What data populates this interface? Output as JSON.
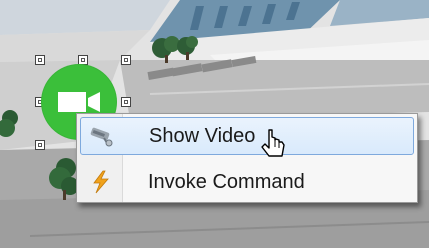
{
  "context_menu": {
    "items": [
      {
        "label": "Show Video",
        "icon": "security-camera-icon",
        "highlighted": true
      },
      {
        "label": "Invoke Command",
        "icon": "lightning-bolt-icon",
        "highlighted": false
      }
    ]
  },
  "map": {
    "marker_icon": "video-camera-icon",
    "marker_color": "#3bbf3a",
    "selection": "selected"
  },
  "colors": {
    "menu_highlight_border": "#7ea9dd",
    "menu_background": "#f7f7f7"
  }
}
